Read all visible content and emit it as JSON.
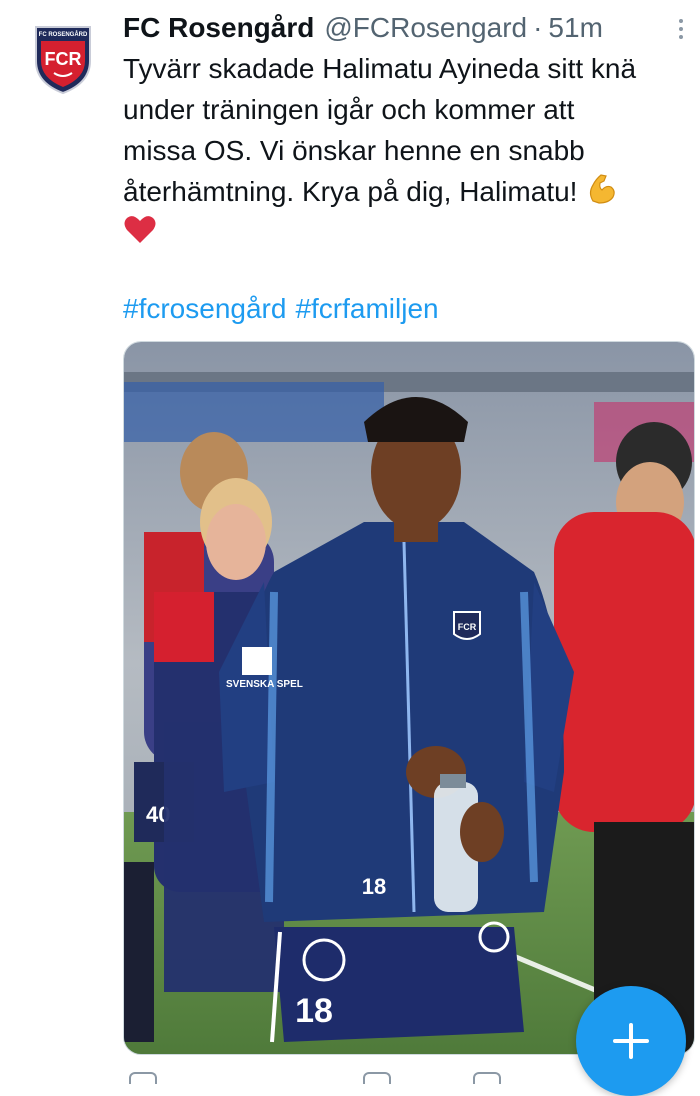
{
  "tweet": {
    "author_name": "FC Rosengård",
    "author_handle": "@FCRosengard",
    "separator": "·",
    "timestamp": "51m",
    "text_lines": [
      "Tyvärr skadade Halimatu Ayineda sitt knä",
      "under träningen igår och kommer att",
      "missa OS. Vi önskar henne en snabb",
      "återhämtning. Krya på dig, Halimatu!"
    ],
    "emojis": [
      "flexed-biceps-icon",
      "red-heart-icon"
    ],
    "hashtags": [
      "#fcrosengård",
      "#fcrfamiljen"
    ]
  },
  "avatar": {
    "logo_arc_text": "FC ROSENGÅRD",
    "logo_letters": "FCR"
  },
  "photo": {
    "jersey_number": "18",
    "shorts_number": "18",
    "crest_letters": "FCR",
    "sponsor": "SVENSKA SPEL",
    "teammate_number": "40"
  },
  "fab": {
    "label": "+",
    "icon": "compose-plus-icon"
  },
  "colors": {
    "accent": "#1d9bf0",
    "text": "#0f1419",
    "muted": "#536471",
    "jacket": "#1f3a78",
    "club_red": "#d5202f"
  }
}
